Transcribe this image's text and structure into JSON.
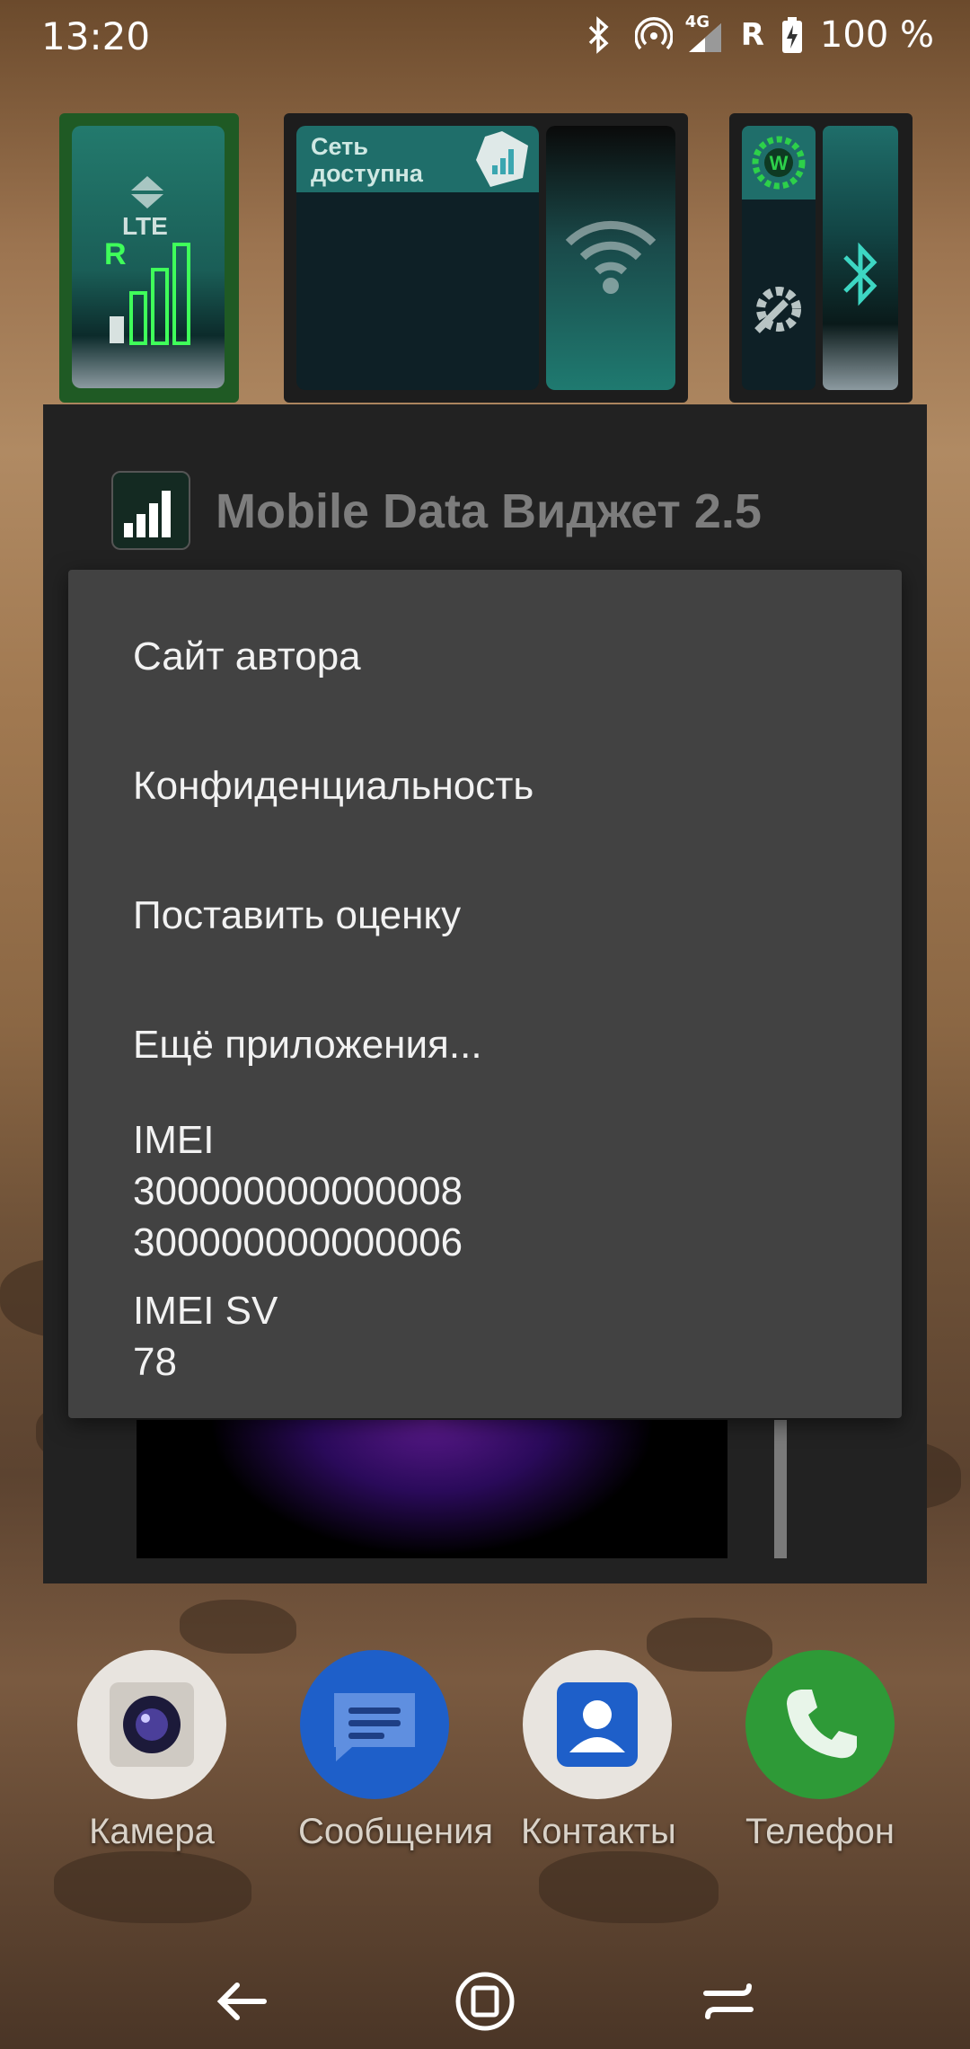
{
  "status_bar": {
    "time": "13:20",
    "network_type": "4G",
    "roaming": "R",
    "battery": "100 %",
    "icons": [
      "bluetooth-icon",
      "hotspot-icon",
      "signal-icon",
      "battery-charging-icon"
    ]
  },
  "widgets": {
    "mobile_data": {
      "label": "LTE",
      "roaming": "R"
    },
    "network": {
      "status": "Сеть доступна"
    },
    "quick_icons": [
      "wifi-icon",
      "bluetooth-icon",
      "settings-gear-icon",
      "w-badge-icon"
    ]
  },
  "dialog": {
    "title": "Mobile Data Виджет 2.5"
  },
  "menu": {
    "items": [
      {
        "label": "Сайт автора"
      },
      {
        "label": "Конфиденциальность"
      },
      {
        "label": "Поставить оценку"
      },
      {
        "label": "Ещё приложения..."
      }
    ],
    "imei_title": "IMEI",
    "imei_1": "300000000000008",
    "imei_2": "300000000000006",
    "imei_sv_title": "IMEI SV",
    "imei_sv": "78"
  },
  "dock": [
    {
      "label": "Камера",
      "icon": "camera-icon",
      "color": "#e8e4df"
    },
    {
      "label": "Сообщения",
      "icon": "messages-icon",
      "color": "#1e5fc9"
    },
    {
      "label": "Контакты",
      "icon": "contacts-icon",
      "color": "#e8e4df"
    },
    {
      "label": "Телефон",
      "icon": "phone-icon",
      "color": "#2e9a37"
    }
  ],
  "nav": [
    "back-icon",
    "home-icon",
    "recents-icon"
  ]
}
